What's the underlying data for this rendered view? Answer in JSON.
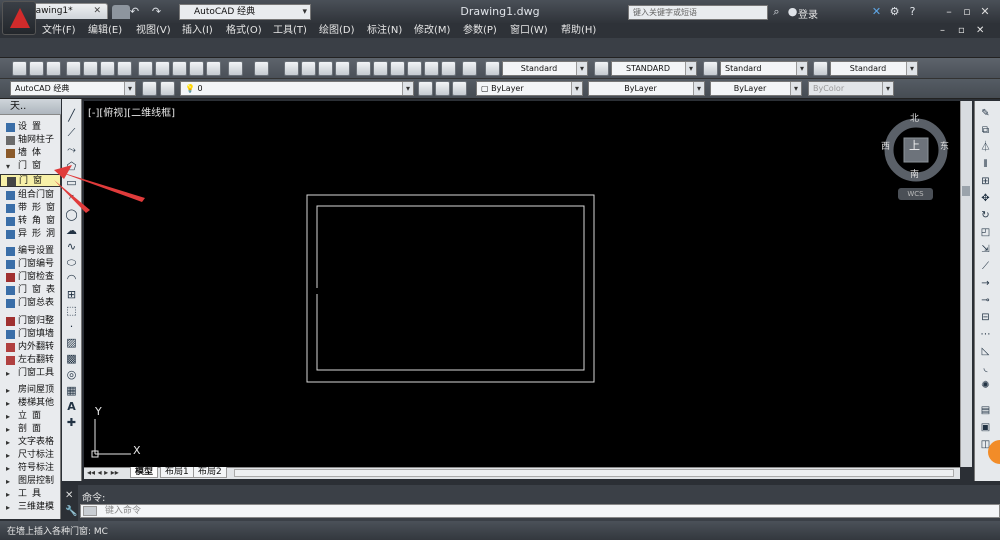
{
  "title_bar": {
    "workspace": "AutoCAD 经典",
    "document_title": "Drawing1.dwg",
    "search_placeholder": "键入关键字或短语",
    "login": "登录",
    "help": "?"
  },
  "menu": [
    "文件(F)",
    "编辑(E)",
    "视图(V)",
    "插入(I)",
    "格式(O)",
    "工具(T)",
    "绘图(D)",
    "标注(N)",
    "修改(M)",
    "参数(P)",
    "窗口(W)",
    "帮助(H)"
  ],
  "doc_tab": {
    "label": "Drawing1*",
    "close": "✕"
  },
  "styles_toolbar": {
    "text_style": "Standard",
    "dim_style": "STANDARD",
    "table_style": "Standard",
    "mleader_style": "Standard"
  },
  "layers_toolbar": {
    "workspace": "AutoCAD 经典",
    "layer": "0",
    "color": "ByLayer",
    "linetype": "ByLayer",
    "lineweight": "ByLayer",
    "plotstyle": "ByColor"
  },
  "palette": {
    "header": "天..",
    "items": [
      {
        "label": "设置",
        "spread": true
      },
      {
        "label": "轴网柱子",
        "spread": false
      },
      {
        "label": "墙体",
        "spread": true
      },
      {
        "label": "门窗",
        "spread": true,
        "type": "group"
      },
      {
        "label": "门窗",
        "spread": true,
        "selected": true
      },
      {
        "label": "组合门窗",
        "spread": false
      },
      {
        "label": "带形窗",
        "spread": true
      },
      {
        "label": "转角窗",
        "spread": true
      },
      {
        "label": "异形洞",
        "spread": true
      },
      {
        "label": "编号设置",
        "spread": false
      },
      {
        "label": "门窗编号",
        "spread": false
      },
      {
        "label": "门窗检查",
        "spread": false
      },
      {
        "label": "门窗表",
        "spread": true
      },
      {
        "label": "门窗总表",
        "spread": false
      },
      {
        "label": "门窗归整",
        "spread": false
      },
      {
        "label": "门窗填墙",
        "spread": false
      },
      {
        "label": "内外翻转",
        "spread": false
      },
      {
        "label": "左右翻转",
        "spread": false
      },
      {
        "label": "门窗工具",
        "spread": false,
        "type": "group"
      },
      {
        "label": "房间屋顶",
        "spread": false,
        "type": "group"
      },
      {
        "label": "楼梯其他",
        "spread": false,
        "type": "group"
      },
      {
        "label": "立面",
        "spread": true,
        "type": "group"
      },
      {
        "label": "剖面",
        "spread": true,
        "type": "group"
      },
      {
        "label": "文字表格",
        "spread": false,
        "type": "group"
      },
      {
        "label": "尺寸标注",
        "spread": false,
        "type": "group"
      },
      {
        "label": "符号标注",
        "spread": false,
        "type": "group"
      },
      {
        "label": "图层控制",
        "spread": false,
        "type": "group"
      },
      {
        "label": "工具",
        "spread": true,
        "type": "group"
      },
      {
        "label": "三维建模",
        "spread": false,
        "type": "group"
      }
    ]
  },
  "viewport_label": "[-][俯视][二维线框]",
  "viewcube": {
    "north": "北",
    "south": "南",
    "east": "东",
    "west": "西",
    "top": "上",
    "wcs": "WCS"
  },
  "ucs": {
    "x": "X",
    "y": "Y"
  },
  "layout_tabs": [
    "模型",
    "布局1",
    "布局2"
  ],
  "command": {
    "label": "命令:",
    "placeholder": "键入命令"
  },
  "status_text": "在墙上插入各种门窗: MC",
  "colors": {
    "canvas": "#000000",
    "selection_highlight": "#f7f0a8",
    "annotation_arrow": "#e03b3b",
    "app_red": "#d12b2b"
  }
}
